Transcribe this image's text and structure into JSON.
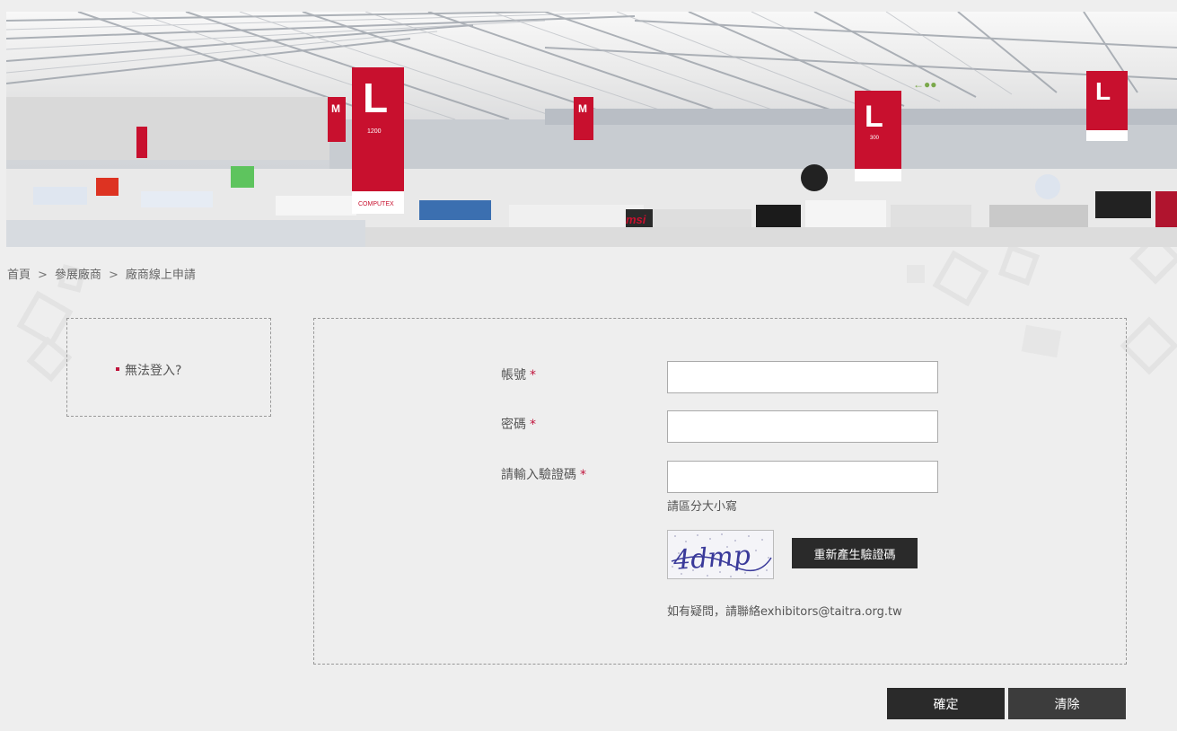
{
  "breadcrumb": {
    "home": "首頁",
    "separator": ">",
    "level1": "參展廠商",
    "level2": "廠商線上申請"
  },
  "sidebar": {
    "link_label": "無法登入?"
  },
  "form": {
    "account_label": "帳號",
    "password_label": "密碼",
    "captcha_label": "請輸入驗證碼",
    "required_mark": "*",
    "account_value": "",
    "password_value": "",
    "captcha_value": "",
    "case_hint": "請區分大小寫",
    "captcha_text": "4dmp",
    "regenerate_label": "重新產生驗證碼",
    "contact_text": "如有疑問，請聯絡exhibitors@taitra.org.tw"
  },
  "actions": {
    "confirm_label": "確定",
    "clear_label": "清除"
  },
  "banner": {
    "sign_letters": [
      "M",
      "L",
      "M",
      "L",
      "L"
    ],
    "sign_numbers": [
      "1200",
      "300"
    ],
    "brand_texts": [
      "COMPUTEX",
      "msi"
    ]
  },
  "colors": {
    "accent": "#c0143c",
    "dark_button": "#2a2a2a",
    "page_bg": "#eeeeee"
  }
}
